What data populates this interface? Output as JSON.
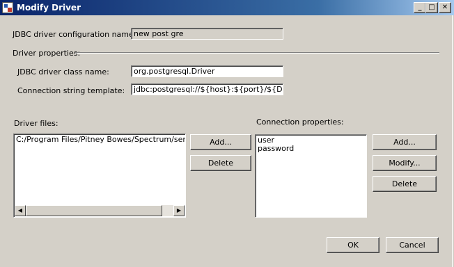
{
  "window": {
    "title": "Modify Driver",
    "controls": {
      "minimize": "_",
      "maximize": "□",
      "close": "✕"
    }
  },
  "config_name": {
    "label": "JDBC driver configuration name:",
    "value": "new post gre"
  },
  "driver_properties": {
    "heading": "Driver properties:",
    "class_name_label": "JDBC driver class name:",
    "class_name_value": "org.postgresql.Driver",
    "conn_template_label": "Connection string template:",
    "conn_template_value": "jdbc:postgresql://${host}:${port}/${DBinstance}"
  },
  "driver_files": {
    "label": "Driver files:",
    "items": [
      "C:/Program Files/Pitney Bowes/Spectrum/server/p"
    ],
    "add_label": "Add...",
    "delete_label": "Delete"
  },
  "connection_properties": {
    "label": "Connection properties:",
    "items": [
      "user",
      "password"
    ],
    "add_label": "Add...",
    "modify_label": "Modify...",
    "delete_label": "Delete"
  },
  "footer": {
    "ok_label": "OK",
    "cancel_label": "Cancel"
  },
  "icons": {
    "scroll_left": "◀",
    "scroll_right": "▶"
  }
}
